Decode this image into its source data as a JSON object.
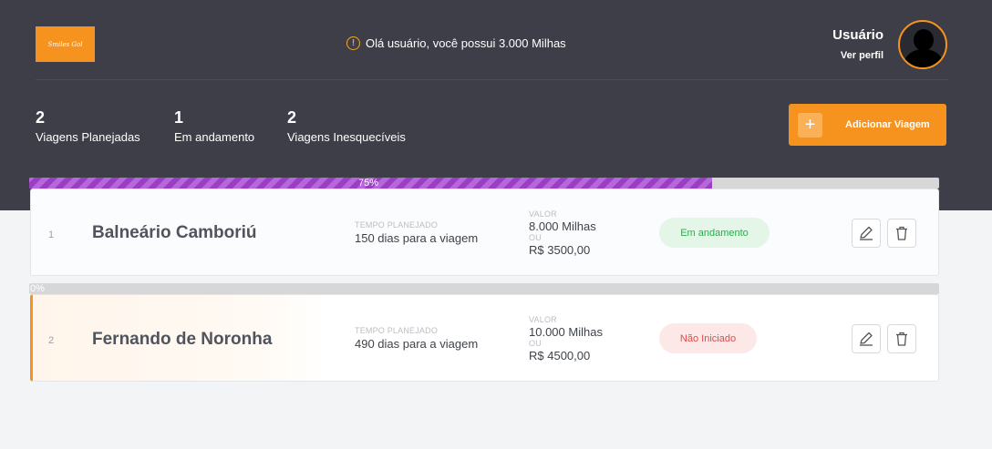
{
  "header": {
    "logo_text": "Smiles Gol",
    "greeting": "Olá usuário, você possui 3.000 Milhas",
    "user_name": "Usuário",
    "profile_link": "Ver perfil"
  },
  "stats": [
    {
      "value": "2",
      "label": "Viagens Planejadas"
    },
    {
      "value": "1",
      "label": "Em andamento"
    },
    {
      "value": "2",
      "label": "Viagens Inesquecíveis"
    }
  ],
  "add_button": {
    "icon": "+",
    "label": "Adicionar Viagem"
  },
  "colors": {
    "accent": "#f6921e",
    "header": "#3e3e48",
    "progress": "#9b3ec4"
  },
  "trips": [
    {
      "index": "1",
      "city": "Balneário Camboriú",
      "time_label": "TEMPO PLANEJADO",
      "time_value": "150 dias para a viagem",
      "value_label": "VALOR",
      "miles": "8.000 Milhas",
      "or_label": "OU",
      "price": "R$ 3500,00",
      "status": "Em andamento",
      "progress_label": "75%",
      "progress": 0.75
    },
    {
      "index": "2",
      "city": "Fernando de Noronha",
      "time_label": "TEMPO PLANEJADO",
      "time_value": "490 dias para a viagem",
      "value_label": "VALOR",
      "miles": "10.000 Milhas",
      "or_label": "OU",
      "price": "R$ 4500,00",
      "status": "Não Iniciado",
      "progress_label": "0%",
      "progress": 0
    }
  ]
}
